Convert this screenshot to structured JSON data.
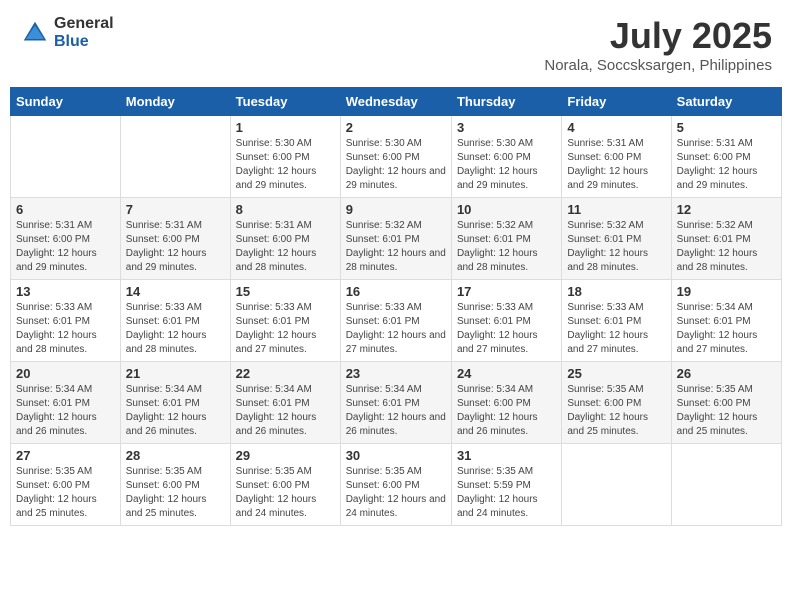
{
  "logo": {
    "general": "General",
    "blue": "Blue"
  },
  "header": {
    "title": "July 2025",
    "subtitle": "Norala, Soccsksargen, Philippines"
  },
  "weekdays": [
    "Sunday",
    "Monday",
    "Tuesday",
    "Wednesday",
    "Thursday",
    "Friday",
    "Saturday"
  ],
  "weeks": [
    [
      {
        "day": "",
        "info": ""
      },
      {
        "day": "",
        "info": ""
      },
      {
        "day": "1",
        "info": "Sunrise: 5:30 AM\nSunset: 6:00 PM\nDaylight: 12 hours and 29 minutes."
      },
      {
        "day": "2",
        "info": "Sunrise: 5:30 AM\nSunset: 6:00 PM\nDaylight: 12 hours and 29 minutes."
      },
      {
        "day": "3",
        "info": "Sunrise: 5:30 AM\nSunset: 6:00 PM\nDaylight: 12 hours and 29 minutes."
      },
      {
        "day": "4",
        "info": "Sunrise: 5:31 AM\nSunset: 6:00 PM\nDaylight: 12 hours and 29 minutes."
      },
      {
        "day": "5",
        "info": "Sunrise: 5:31 AM\nSunset: 6:00 PM\nDaylight: 12 hours and 29 minutes."
      }
    ],
    [
      {
        "day": "6",
        "info": "Sunrise: 5:31 AM\nSunset: 6:00 PM\nDaylight: 12 hours and 29 minutes."
      },
      {
        "day": "7",
        "info": "Sunrise: 5:31 AM\nSunset: 6:00 PM\nDaylight: 12 hours and 29 minutes."
      },
      {
        "day": "8",
        "info": "Sunrise: 5:31 AM\nSunset: 6:00 PM\nDaylight: 12 hours and 28 minutes."
      },
      {
        "day": "9",
        "info": "Sunrise: 5:32 AM\nSunset: 6:01 PM\nDaylight: 12 hours and 28 minutes."
      },
      {
        "day": "10",
        "info": "Sunrise: 5:32 AM\nSunset: 6:01 PM\nDaylight: 12 hours and 28 minutes."
      },
      {
        "day": "11",
        "info": "Sunrise: 5:32 AM\nSunset: 6:01 PM\nDaylight: 12 hours and 28 minutes."
      },
      {
        "day": "12",
        "info": "Sunrise: 5:32 AM\nSunset: 6:01 PM\nDaylight: 12 hours and 28 minutes."
      }
    ],
    [
      {
        "day": "13",
        "info": "Sunrise: 5:33 AM\nSunset: 6:01 PM\nDaylight: 12 hours and 28 minutes."
      },
      {
        "day": "14",
        "info": "Sunrise: 5:33 AM\nSunset: 6:01 PM\nDaylight: 12 hours and 28 minutes."
      },
      {
        "day": "15",
        "info": "Sunrise: 5:33 AM\nSunset: 6:01 PM\nDaylight: 12 hours and 27 minutes."
      },
      {
        "day": "16",
        "info": "Sunrise: 5:33 AM\nSunset: 6:01 PM\nDaylight: 12 hours and 27 minutes."
      },
      {
        "day": "17",
        "info": "Sunrise: 5:33 AM\nSunset: 6:01 PM\nDaylight: 12 hours and 27 minutes."
      },
      {
        "day": "18",
        "info": "Sunrise: 5:33 AM\nSunset: 6:01 PM\nDaylight: 12 hours and 27 minutes."
      },
      {
        "day": "19",
        "info": "Sunrise: 5:34 AM\nSunset: 6:01 PM\nDaylight: 12 hours and 27 minutes."
      }
    ],
    [
      {
        "day": "20",
        "info": "Sunrise: 5:34 AM\nSunset: 6:01 PM\nDaylight: 12 hours and 26 minutes."
      },
      {
        "day": "21",
        "info": "Sunrise: 5:34 AM\nSunset: 6:01 PM\nDaylight: 12 hours and 26 minutes."
      },
      {
        "day": "22",
        "info": "Sunrise: 5:34 AM\nSunset: 6:01 PM\nDaylight: 12 hours and 26 minutes."
      },
      {
        "day": "23",
        "info": "Sunrise: 5:34 AM\nSunset: 6:01 PM\nDaylight: 12 hours and 26 minutes."
      },
      {
        "day": "24",
        "info": "Sunrise: 5:34 AM\nSunset: 6:00 PM\nDaylight: 12 hours and 26 minutes."
      },
      {
        "day": "25",
        "info": "Sunrise: 5:35 AM\nSunset: 6:00 PM\nDaylight: 12 hours and 25 minutes."
      },
      {
        "day": "26",
        "info": "Sunrise: 5:35 AM\nSunset: 6:00 PM\nDaylight: 12 hours and 25 minutes."
      }
    ],
    [
      {
        "day": "27",
        "info": "Sunrise: 5:35 AM\nSunset: 6:00 PM\nDaylight: 12 hours and 25 minutes."
      },
      {
        "day": "28",
        "info": "Sunrise: 5:35 AM\nSunset: 6:00 PM\nDaylight: 12 hours and 25 minutes."
      },
      {
        "day": "29",
        "info": "Sunrise: 5:35 AM\nSunset: 6:00 PM\nDaylight: 12 hours and 24 minutes."
      },
      {
        "day": "30",
        "info": "Sunrise: 5:35 AM\nSunset: 6:00 PM\nDaylight: 12 hours and 24 minutes."
      },
      {
        "day": "31",
        "info": "Sunrise: 5:35 AM\nSunset: 5:59 PM\nDaylight: 12 hours and 24 minutes."
      },
      {
        "day": "",
        "info": ""
      },
      {
        "day": "",
        "info": ""
      }
    ]
  ]
}
